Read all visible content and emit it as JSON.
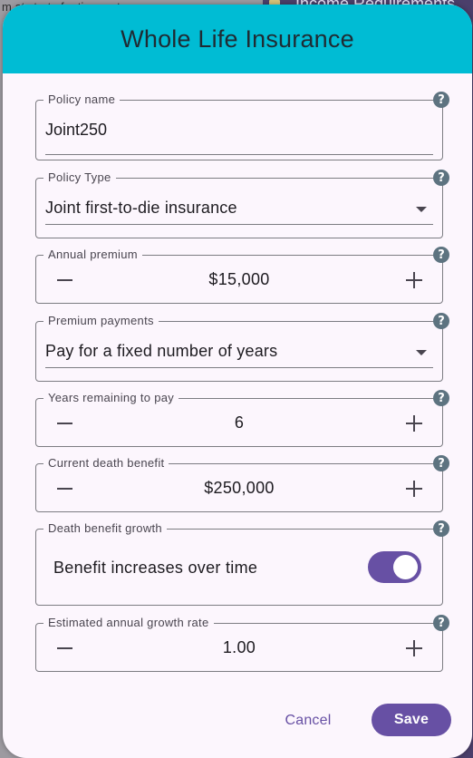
{
  "background": {
    "left_text": "m at start of retirement",
    "right_title": "Income Requirements"
  },
  "dialog": {
    "title": "Whole Life Insurance",
    "help_glyph": "?",
    "fields": {
      "policy_name": {
        "label": "Policy name",
        "value": "Joint250"
      },
      "policy_type": {
        "label": "Policy Type",
        "value": "Joint first-to-die insurance"
      },
      "annual_premium": {
        "label": "Annual premium",
        "value": "$15,000"
      },
      "premium_payments": {
        "label": "Premium payments",
        "value": "Pay for a fixed number of years"
      },
      "years_remaining": {
        "label": "Years remaining to pay",
        "value": "6"
      },
      "death_benefit": {
        "label": "Current death benefit",
        "value": "$250,000"
      },
      "benefit_growth": {
        "label": "Death benefit growth",
        "toggle_label": "Benefit increases over time",
        "toggle_on": true
      },
      "growth_rate": {
        "label": "Estimated annual growth rate",
        "value": "1.00"
      }
    },
    "actions": {
      "cancel": "Cancel",
      "save": "Save"
    }
  },
  "colors": {
    "header": "#00bcd4",
    "accent": "#6750a4",
    "help_icon": "#5d7380",
    "dialog_bg": "#fcf6fd"
  }
}
